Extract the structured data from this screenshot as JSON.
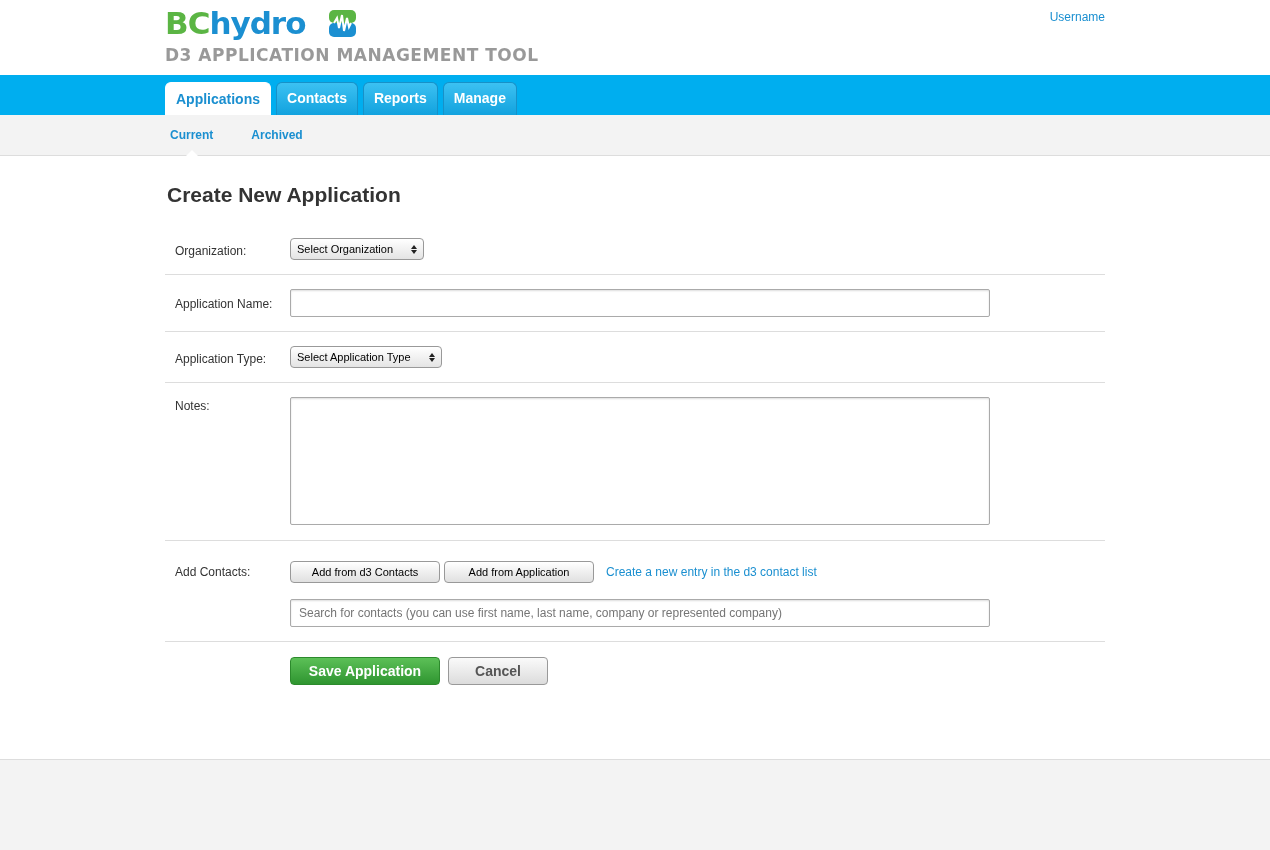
{
  "header": {
    "logo": {
      "part_1": "BC",
      "part_2": "hydro"
    },
    "app_title": "D3 APPLICATION MANAGEMENT TOOL",
    "user": "Username"
  },
  "tabs": [
    {
      "label": "Applications",
      "selected": true
    },
    {
      "label": "Contacts",
      "selected": false
    },
    {
      "label": "Reports",
      "selected": false
    },
    {
      "label": "Manage",
      "selected": false
    }
  ],
  "subtabs": [
    {
      "label": "Current",
      "selected": true
    },
    {
      "label": "Archived",
      "selected": false
    }
  ],
  "page_title": "Create New Application",
  "form": [
    {
      "kind": "select",
      "label": "Organization:",
      "value": "Select Organization"
    },
    {
      "kind": "text",
      "label": "Application Name:"
    },
    {
      "kind": "select",
      "label": "Application Type:",
      "value": "Select Application Type"
    },
    {
      "kind": "textarea",
      "label": "Notes:"
    },
    {
      "kind": "contacts",
      "label": "Add Contacts:",
      "buttons": [
        "Add from d3 Contacts",
        "Add from Application"
      ],
      "link": "Create a new entry in the d3 contact list",
      "placeholder": "Search for contacts (you can use first name, last name, company or represented company)"
    }
  ],
  "actions": [
    {
      "kind": "primary",
      "label": "Save Application"
    },
    {
      "kind": "secondary",
      "label": "Cancel"
    }
  ]
}
